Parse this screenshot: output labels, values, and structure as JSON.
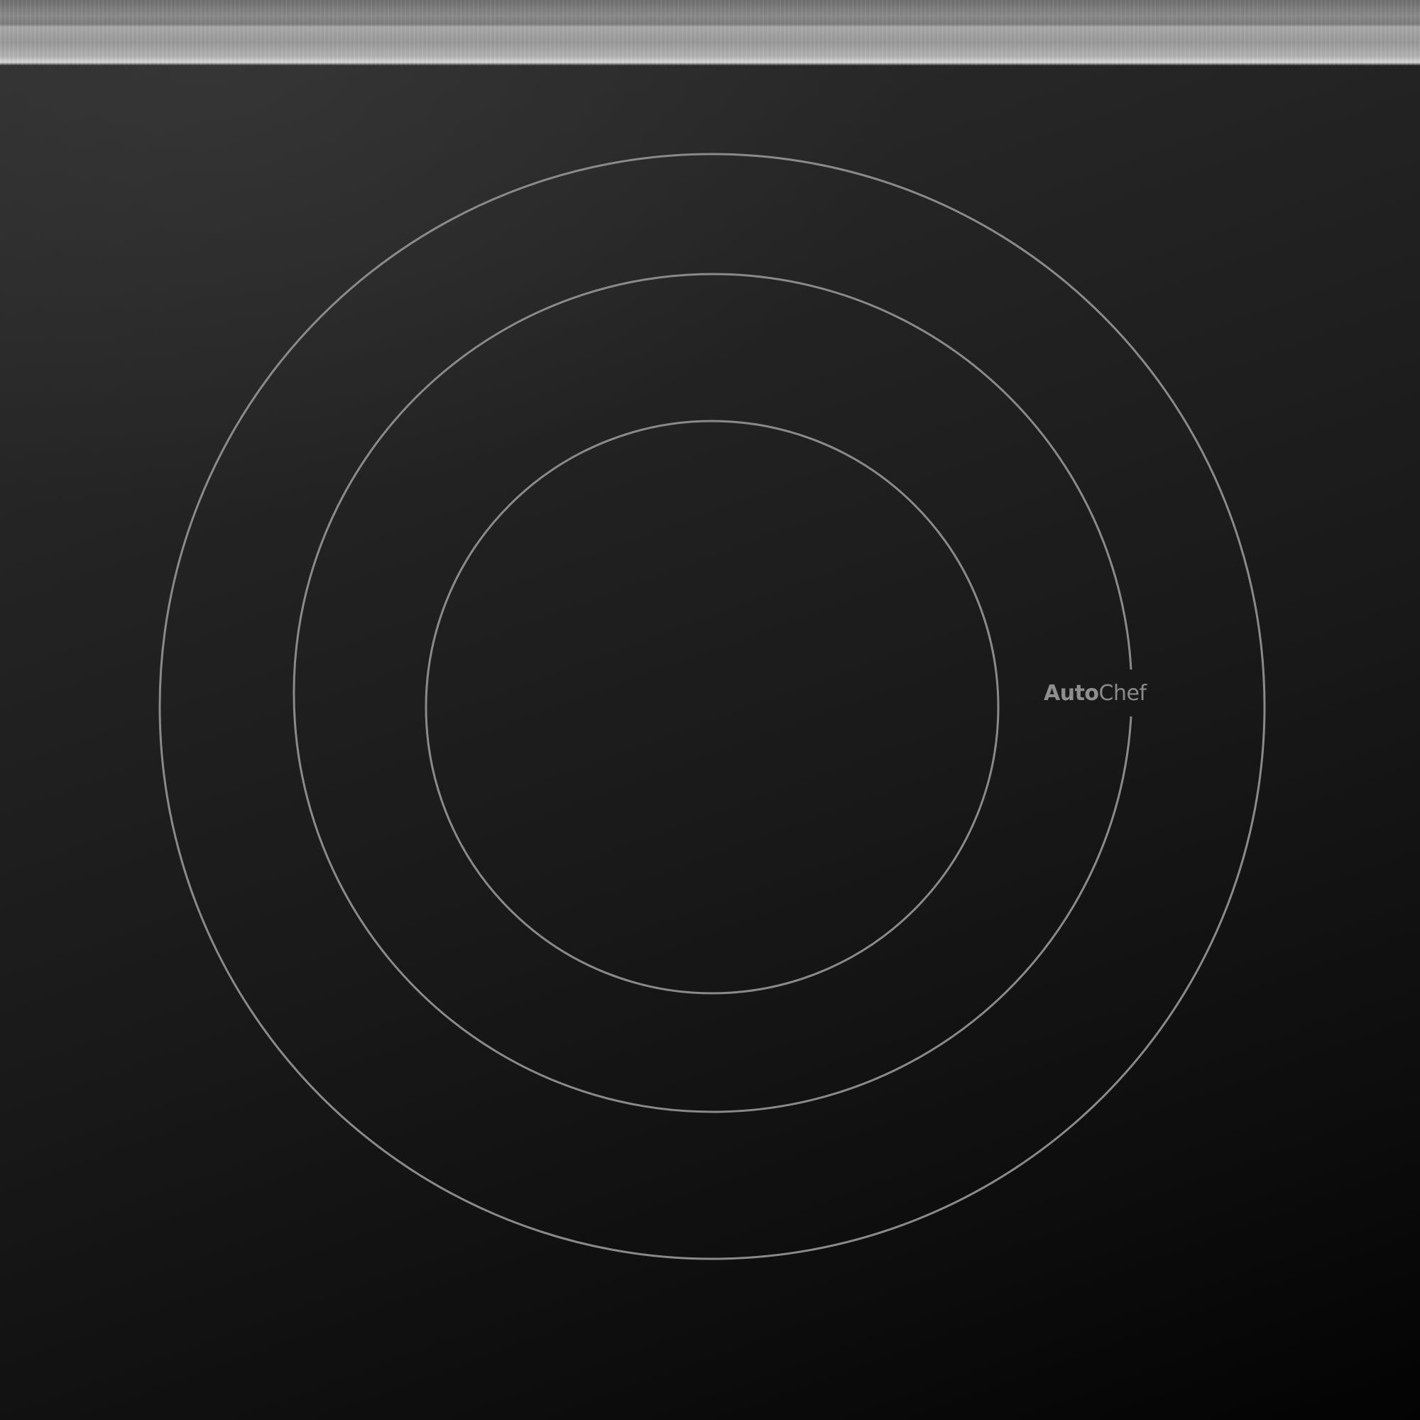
{
  "brand": {
    "logo_bold": "Auto",
    "logo_light": "Chef"
  },
  "colors": {
    "ring": "#8a8a8a",
    "glass_dark": "#050505",
    "glass_light": "#2e2e2e",
    "trim": "#a9a9a9"
  },
  "burner": {
    "ring_count": 3
  }
}
